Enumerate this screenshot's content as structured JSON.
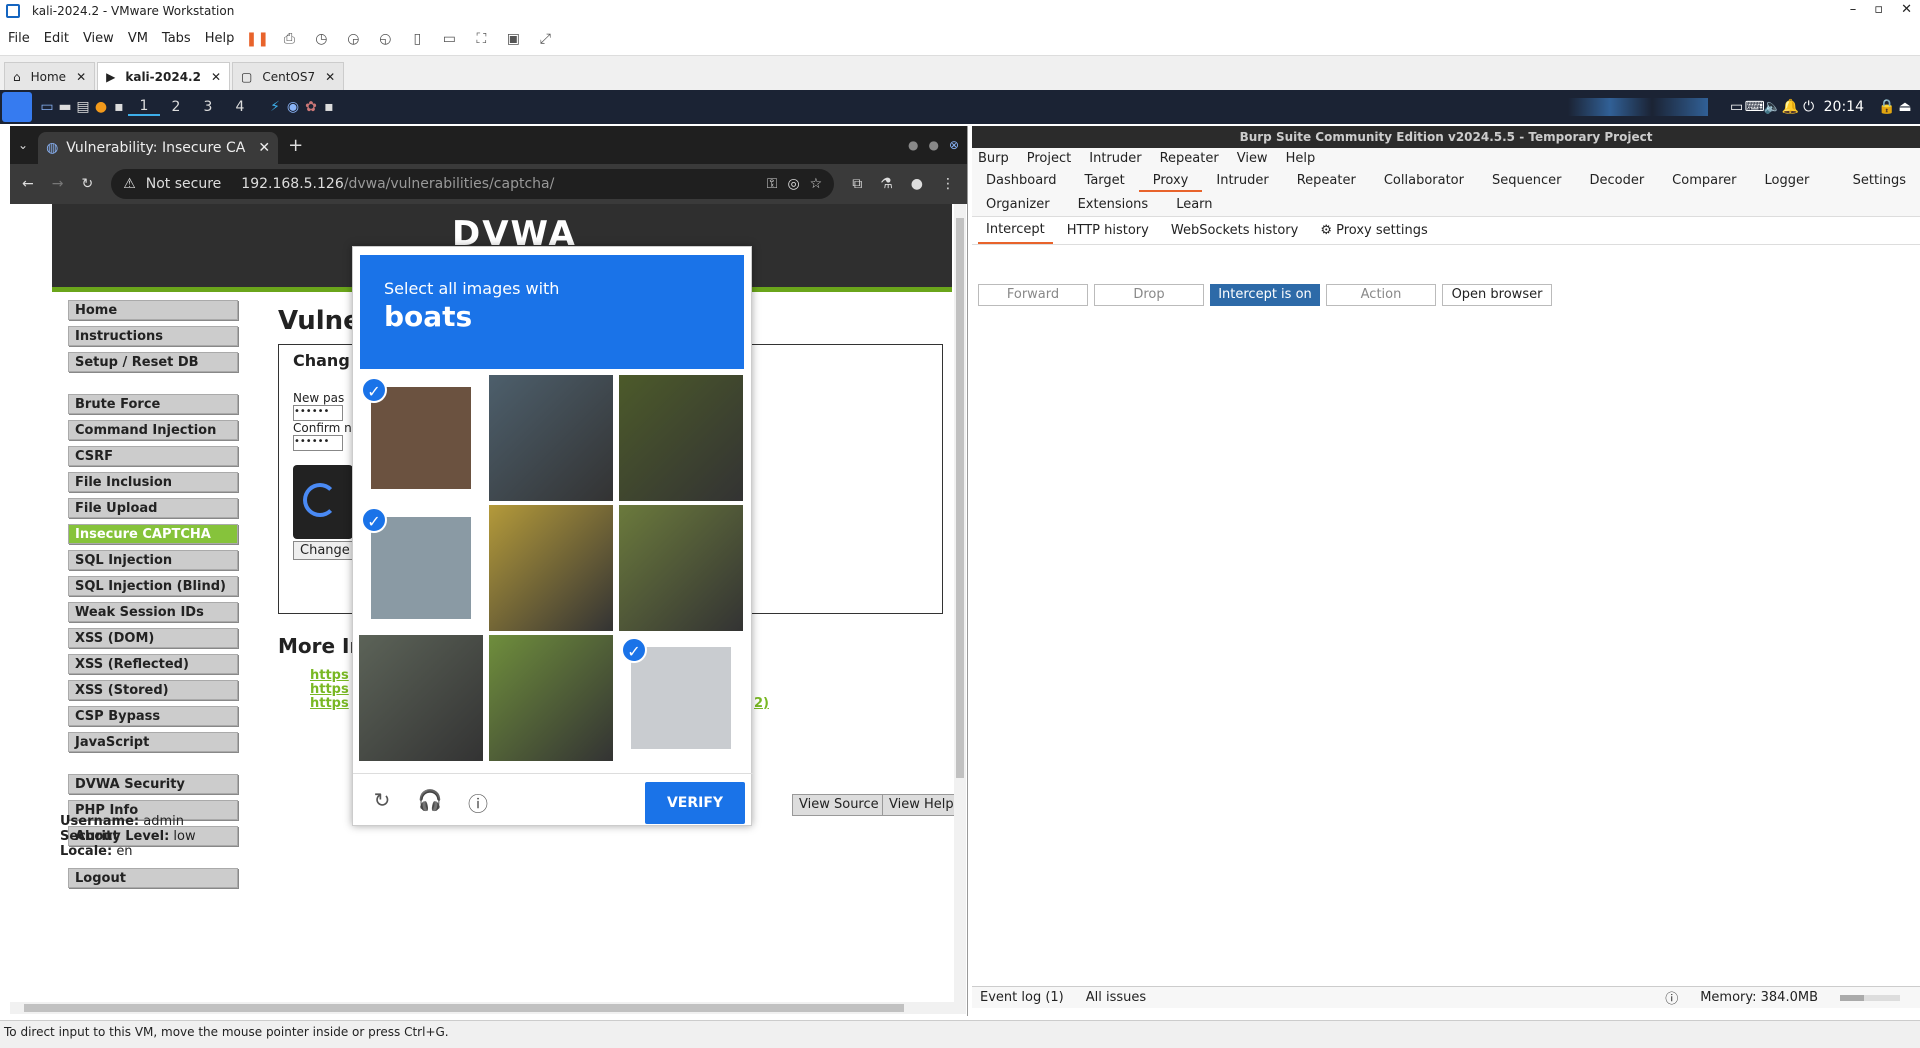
{
  "vmware": {
    "title": "kali-2024.2 - VMware Workstation",
    "menu": [
      "File",
      "Edit",
      "View",
      "VM",
      "Tabs",
      "Help"
    ],
    "tabs": [
      "Home",
      "kali-2024.2",
      "CentOS7"
    ],
    "status": "To direct input to this VM, move the mouse pointer inside or press Ctrl+G."
  },
  "kali": {
    "workspaces": [
      "1",
      "2",
      "3",
      "4"
    ],
    "time": "20:14"
  },
  "browser": {
    "tab_title": "Vulnerability: Insecure CA",
    "not_secure": "Not secure",
    "url_host": "192.168.5.126",
    "url_path": "/dvwa/vulnerabilities/captcha/"
  },
  "dvwa": {
    "logo": "DVWA",
    "title": "Vulner",
    "form_heading": "Chang",
    "new_pass_label": "New pas",
    "confirm_label": "Confirm n",
    "pass_value": "••••••",
    "change_button": "Change",
    "more_info": "More In",
    "links": [
      "https",
      "https",
      "https"
    ],
    "link_tail": "2)",
    "menu": [
      "Home",
      "Instructions",
      "Setup / Reset DB",
      "Brute Force",
      "Command Injection",
      "CSRF",
      "File Inclusion",
      "File Upload",
      "Insecure CAPTCHA",
      "SQL Injection",
      "SQL Injection (Blind)",
      "Weak Session IDs",
      "XSS (DOM)",
      "XSS (Reflected)",
      "XSS (Stored)",
      "CSP Bypass",
      "JavaScript",
      "DVWA Security",
      "PHP Info",
      "About",
      "Logout"
    ],
    "selected": "Insecure CAPTCHA",
    "username_label": "Username:",
    "username": "admin",
    "security_label": "Security Level:",
    "security": "low",
    "locale_label": "Locale:",
    "locale": "en",
    "view_source": "View Source",
    "view_help": "View Help"
  },
  "captcha": {
    "instruction": "Select all images with",
    "target": "boats",
    "verify": "VERIFY",
    "tiles": [
      {
        "name": "boat-on-trailer",
        "checked": true,
        "color": "#6b5240"
      },
      {
        "name": "car-door",
        "checked": false,
        "color": "#4d5f6c"
      },
      {
        "name": "jeep-on-lawn",
        "checked": false,
        "color": "#4c5a2a"
      },
      {
        "name": "boat-on-street",
        "checked": true,
        "color": "#8a9aa4"
      },
      {
        "name": "yellow-truck",
        "checked": false,
        "color": "#b49a3a"
      },
      {
        "name": "guardrail-grass",
        "checked": false,
        "color": "#6b7a3c"
      },
      {
        "name": "road-sign",
        "checked": false,
        "color": "#5c6358"
      },
      {
        "name": "guardrail-field",
        "checked": false,
        "color": "#6f8e3c"
      },
      {
        "name": "white-boat",
        "checked": true,
        "color": "#c9ccd0"
      }
    ]
  },
  "burp": {
    "title": "Burp Suite Community Edition v2024.5.5 - Temporary Project",
    "menu": [
      "Burp",
      "Project",
      "Intruder",
      "Repeater",
      "View",
      "Help"
    ],
    "tabs": [
      "Dashboard",
      "Target",
      "Proxy",
      "Intruder",
      "Repeater",
      "Collaborator",
      "Sequencer",
      "Decoder",
      "Comparer",
      "Logger",
      "Settings",
      "Organizer",
      "Extensions",
      "Learn"
    ],
    "selected_tab": "Proxy",
    "proxy_tabs": [
      "Intercept",
      "HTTP history",
      "WebSockets history",
      "Proxy settings"
    ],
    "buttons": [
      "Forward",
      "Drop",
      "Intercept is on",
      "Action",
      "Open browser"
    ],
    "event_log": "Event log (1)",
    "all_issues": "All issues",
    "memory": "Memory: 384.0MB"
  }
}
